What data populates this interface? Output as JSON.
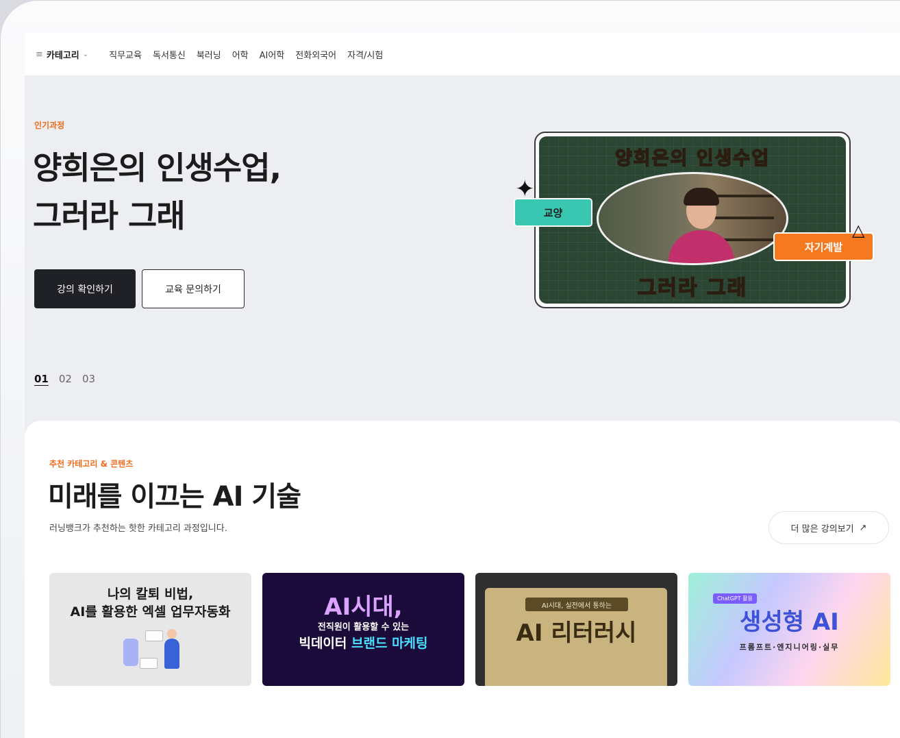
{
  "nav": {
    "category_label": "카테고리",
    "items": [
      "직무교육",
      "독서통신",
      "북러닝",
      "어학",
      "AI어학",
      "전화외국어",
      "자격/시험"
    ]
  },
  "hero": {
    "eyebrow": "인기과정",
    "title_line1": "양희은의 인생수업,",
    "title_line2": "그러라 그래",
    "primary_button": "강의 확인하기",
    "secondary_button": "교육 문의하기",
    "pages": [
      "01",
      "02",
      "03"
    ],
    "active_page": "01",
    "image": {
      "top_text": "양희은의 인생수업",
      "bottom_text": "그러라 그래",
      "tag_left": "교양",
      "tag_right": "자기계발"
    }
  },
  "section": {
    "eyebrow": "추천 카테고리 & 콘텐츠",
    "title": "미래를 이끄는 AI 기술",
    "subtitle": "러닝뱅크가 추천하는 핫한 카테고리 과정입니다.",
    "more_button": "더 많은 강의보기",
    "cards": [
      {
        "line1": "나의 칼퇴 비법,",
        "line2": "AI를 활용한 엑셀 업무자동화"
      },
      {
        "line1": "AI시대,",
        "line2": "전직원이 활용할 수 있는",
        "line3a": "빅데이터 ",
        "line3b": "브랜드 마케팅"
      },
      {
        "badge": "AI시대, 실전에서 통하는",
        "line1": "AI 리터러시"
      },
      {
        "mini": "ChatGPT 활용",
        "line1": "생성형 AI",
        "line2": "프롬프트·엔지니어링·실무"
      }
    ]
  },
  "colors": {
    "accent": "#f26b1d",
    "dark_button": "#1f2126",
    "tag_teal": "#3ac7b1",
    "tag_orange": "#f5791f"
  }
}
